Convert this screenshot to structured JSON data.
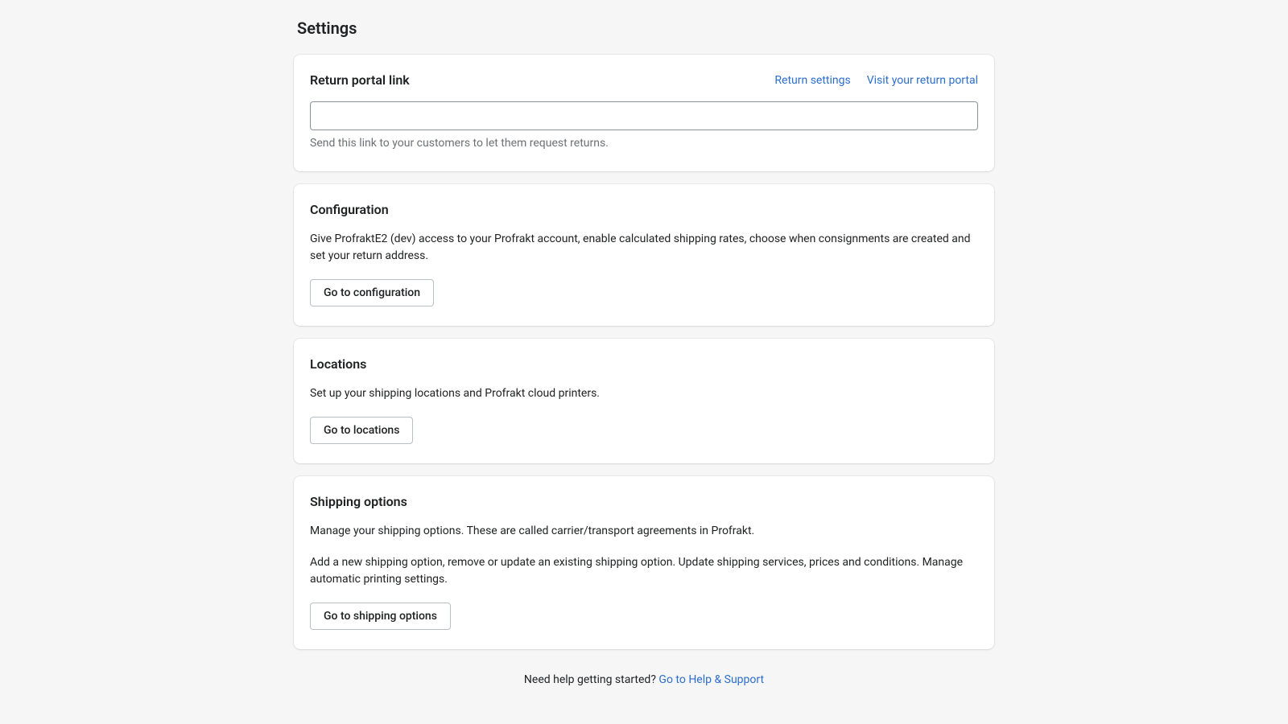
{
  "page": {
    "title": "Settings"
  },
  "return_portal": {
    "title": "Return portal link",
    "link_return_settings": "Return settings",
    "link_visit_portal": "Visit your return portal",
    "input_value": "",
    "helper": "Send this link to your customers to let them request returns."
  },
  "configuration": {
    "title": "Configuration",
    "description": "Give ProfraktE2 (dev) access to your Profrakt account, enable calculated shipping rates, choose when consignments are created and set your return address.",
    "button": "Go to configuration"
  },
  "locations": {
    "title": "Locations",
    "description": "Set up your shipping locations and Profrakt cloud printers.",
    "button": "Go to locations"
  },
  "shipping_options": {
    "title": "Shipping options",
    "description1": "Manage your shipping options. These are called carrier/transport agreements in Profrakt.",
    "description2": "Add a new shipping option, remove or update an existing shipping option. Update shipping services, prices and conditions. Manage automatic printing settings.",
    "button": "Go to shipping options"
  },
  "footer": {
    "text": "Need help getting started? ",
    "link": "Go to Help & Support"
  }
}
